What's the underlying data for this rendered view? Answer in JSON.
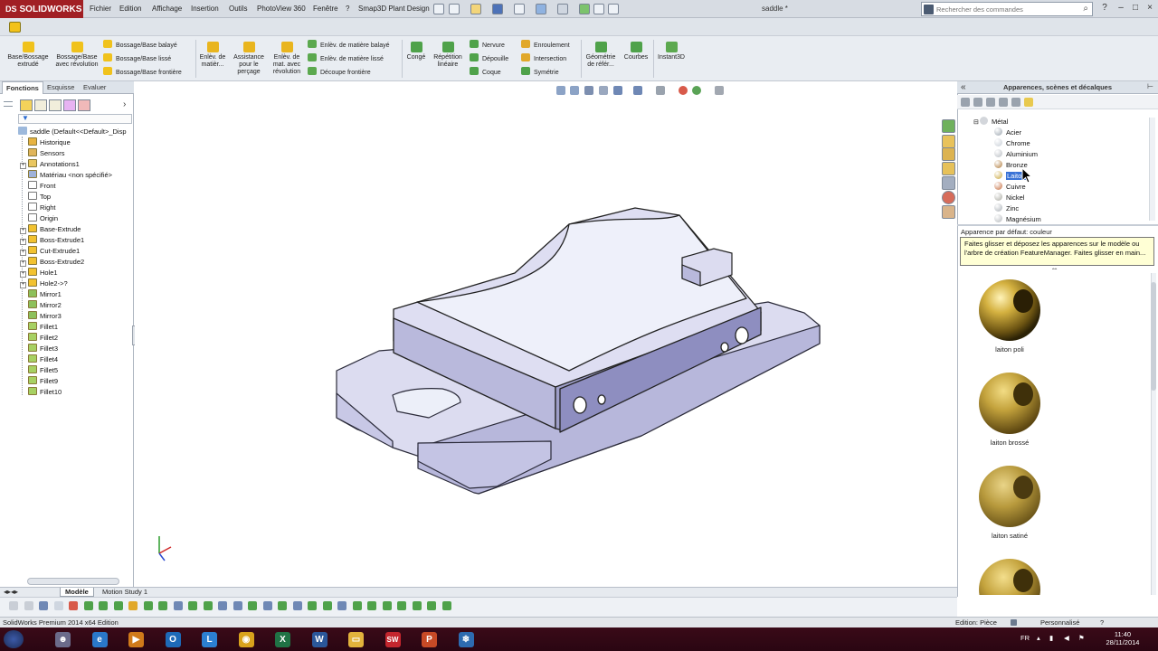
{
  "app": {
    "brand": "SOLIDWORKS",
    "menus": [
      "Fichier",
      "Edition",
      "Affichage",
      "Insertion",
      "Outils",
      "PhotoView 360",
      "Fenêtre",
      "?",
      "Smap3D Plant Design"
    ],
    "document_title": "saddle *",
    "search_placeholder": "Rechercher des commandes",
    "window_controls": [
      "?",
      "–",
      "□",
      "×"
    ]
  },
  "command_manager": {
    "big_tools": [
      {
        "label": "Base/Bossage extrudé",
        "icon": "extrude-boss-icon"
      },
      {
        "label": "Bossage/Base avec révolution",
        "icon": "revolve-boss-icon"
      },
      {
        "label": "Enlèv. de matièr...",
        "icon": "extrude-cut-icon"
      },
      {
        "label": "Assistance pour le perçage",
        "icon": "hole-wizard-icon"
      },
      {
        "label": "Enlèv. de mat. avec révolution",
        "icon": "revolve-cut-icon"
      },
      {
        "label": "Congé",
        "icon": "fillet-icon"
      },
      {
        "label": "Répétition linéaire",
        "icon": "linear-pattern-icon"
      },
      {
        "label": "Géométrie de référ...",
        "icon": "reference-geometry-icon"
      },
      {
        "label": "Courbes",
        "icon": "curves-icon"
      },
      {
        "label": "Instant3D",
        "icon": "instant3d-icon"
      }
    ],
    "small_tools_boss": [
      "Bossage/Base balayé",
      "Bossage/Base lissé",
      "Bossage/Base frontière"
    ],
    "small_tools_cut": [
      "Enlèv. de matière balayé",
      "Enlèv. de matière lissé",
      "Découpe frontière"
    ],
    "small_tools_features": [
      "Nervure",
      "Dépouille",
      "Coque"
    ],
    "small_tools_more": [
      "Enroulement",
      "Intersection",
      "Symétrie"
    ]
  },
  "feature_manager": {
    "tabs": [
      "Fonctions",
      "Esquisse",
      "Evaluer"
    ],
    "active_tab": "Fonctions",
    "root": "saddle  (Default<<Default>_Disp",
    "items": [
      {
        "label": "Historique",
        "icon": "history-icon",
        "expand": false
      },
      {
        "label": "Sensors",
        "icon": "sensor-icon",
        "expand": false
      },
      {
        "label": "Annotations1",
        "icon": "annotations-icon",
        "expand": true
      },
      {
        "label": "Matériau <non spécifié>",
        "icon": "material-icon",
        "expand": false
      },
      {
        "label": "Front",
        "icon": "plane-icon",
        "expand": false
      },
      {
        "label": "Top",
        "icon": "plane-icon",
        "expand": false
      },
      {
        "label": "Right",
        "icon": "plane-icon",
        "expand": false
      },
      {
        "label": "Origin",
        "icon": "origin-icon",
        "expand": false
      },
      {
        "label": "Base-Extrude",
        "icon": "extrude-icon",
        "expand": true
      },
      {
        "label": "Boss-Extrude1",
        "icon": "extrude-icon",
        "expand": true
      },
      {
        "label": "Cut-Extrude1",
        "icon": "cut-icon",
        "expand": true
      },
      {
        "label": "Boss-Extrude2",
        "icon": "extrude-icon",
        "expand": true
      },
      {
        "label": "Hole1",
        "icon": "hole-icon",
        "expand": true
      },
      {
        "label": "Hole2->?",
        "icon": "hole-icon",
        "expand": true
      },
      {
        "label": "Mirror1",
        "icon": "mirror-icon",
        "expand": false
      },
      {
        "label": "Mirror2",
        "icon": "mirror-icon",
        "expand": false
      },
      {
        "label": "Mirror3",
        "icon": "mirror-icon",
        "expand": false
      },
      {
        "label": "Fillet1",
        "icon": "fillet-icon",
        "expand": false
      },
      {
        "label": "Fillet2",
        "icon": "fillet-icon",
        "expand": false
      },
      {
        "label": "Fillet3",
        "icon": "fillet-icon",
        "expand": false
      },
      {
        "label": "Fillet4",
        "icon": "fillet-icon",
        "expand": false
      },
      {
        "label": "Fillet5",
        "icon": "fillet-icon",
        "expand": false
      },
      {
        "label": "Fillet9",
        "icon": "fillet-icon",
        "expand": false
      },
      {
        "label": "Fillet10",
        "icon": "fillet-icon",
        "expand": false
      }
    ]
  },
  "task_pane": {
    "title": "Apparences, scènes et décalques",
    "folder": "Métal",
    "metals": [
      {
        "label": "Acier",
        "color": "#9aa4ae"
      },
      {
        "label": "Chrome",
        "color": "#c7ced6"
      },
      {
        "label": "Aluminium",
        "color": "#b7bcc2"
      },
      {
        "label": "Bronze",
        "color": "#b07a3a"
      },
      {
        "label": "Laiton",
        "color": "#c9a53a",
        "selected": true
      },
      {
        "label": "Cuivre",
        "color": "#c56b3c"
      },
      {
        "label": "Nickel",
        "color": "#a9a9a0"
      },
      {
        "label": "Zinc",
        "color": "#aab0b6"
      },
      {
        "label": "Magnésium",
        "color": "#b4b8bc"
      }
    ],
    "default_appearance": "Apparence par défaut: couleur",
    "tooltip": "Faites glisser et déposez les apparences sur le modèle ou l'arbre de création FeatureManager. Faites glisser en main...",
    "swatches": [
      "laiton poli",
      "laiton brossé",
      "laiton satiné",
      ""
    ]
  },
  "bottom": {
    "tabs": [
      "Modèle",
      "Motion Study 1"
    ],
    "status_left": "SolidWorks Premium 2014 x64 Edition",
    "status_mode": "Edition: Pièce",
    "status_units": "Personnalisé",
    "status_help": "?"
  },
  "taskbar": {
    "apps": [
      {
        "name": "user-app",
        "glyph": "☻",
        "color": "#6b6b8a"
      },
      {
        "name": "internet-explorer",
        "glyph": "e",
        "color": "#2a77c9"
      },
      {
        "name": "media-player",
        "glyph": "▶",
        "color": "#d07a1a"
      },
      {
        "name": "outlook",
        "glyph": "O",
        "color": "#1e6ab7"
      },
      {
        "name": "lync",
        "glyph": "L",
        "color": "#2c7fd1"
      },
      {
        "name": "chrome",
        "glyph": "◉",
        "color": "#d8a21c"
      },
      {
        "name": "excel",
        "glyph": "X",
        "color": "#207245"
      },
      {
        "name": "word",
        "glyph": "W",
        "color": "#2b579a"
      },
      {
        "name": "file-explorer",
        "glyph": "▭",
        "color": "#e2b33c"
      },
      {
        "name": "solidworks",
        "glyph": "SW",
        "color": "#c4262e"
      },
      {
        "name": "powerpoint",
        "glyph": "P",
        "color": "#c84a26"
      },
      {
        "name": "snowflake-app",
        "glyph": "❄",
        "color": "#2d6bb0"
      }
    ],
    "lang": "FR",
    "time": "11:40",
    "date": "28/11/2014"
  }
}
